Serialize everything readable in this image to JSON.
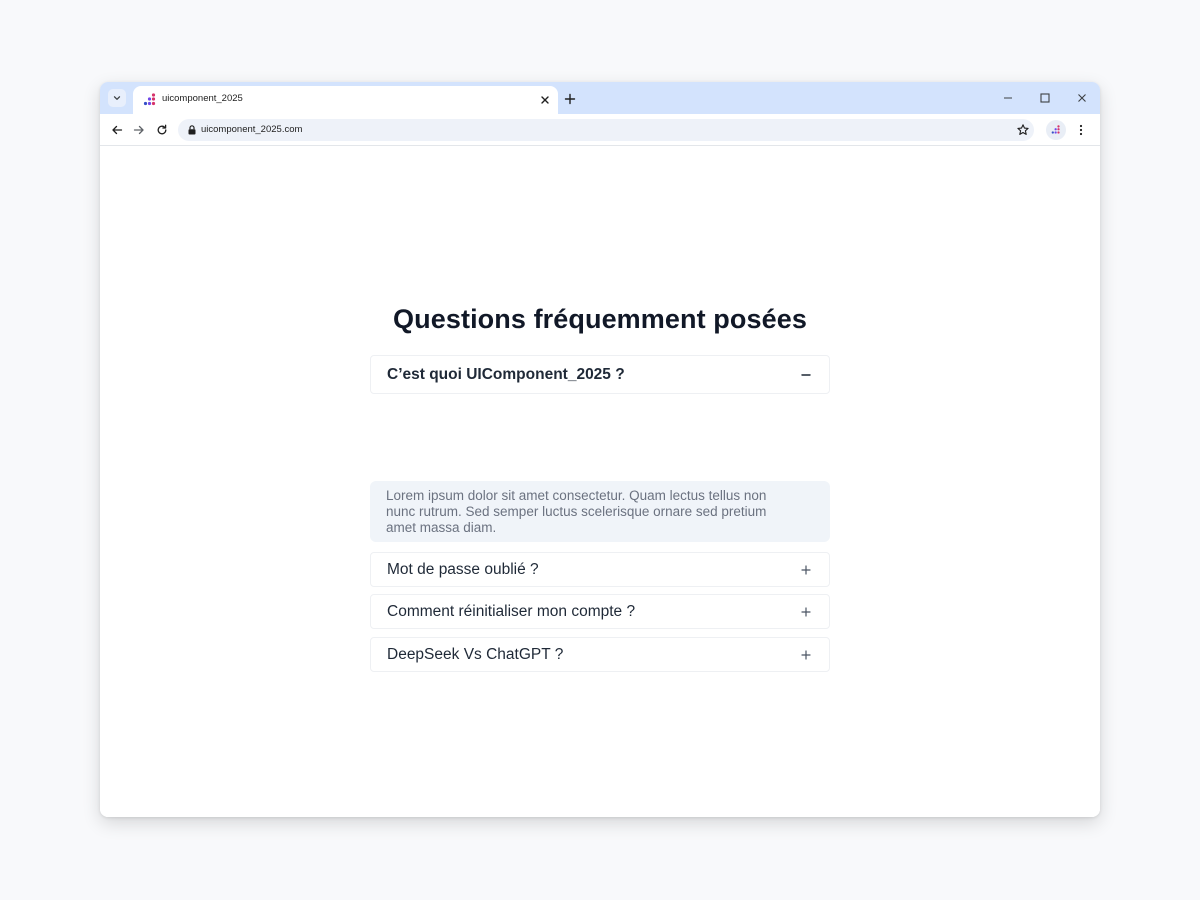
{
  "browser": {
    "tab_title": "uicomponent_2025",
    "url": "uicomponent_2025.com"
  },
  "icons": {
    "tab_list": "chevron-down-icon",
    "favicon": "dots-logo-icon",
    "tab_close": "close-icon",
    "new_tab": "plus-icon",
    "minimize": "minimize-icon",
    "maximize": "maximize-icon",
    "close_window": "close-icon",
    "back": "arrow-left-icon",
    "forward": "arrow-right-icon",
    "reload": "reload-icon",
    "lock": "lock-icon",
    "bookmark": "star-icon",
    "menu": "kebab-menu-icon",
    "expanded": "minus-icon",
    "collapsed": "plus-icon"
  },
  "colors": {
    "tab_bar": "#d3e3fd",
    "title_text": "#111827",
    "answer_background": "#f0f4f9",
    "answer_text": "#6b7280",
    "logo_pink": "#d6336c",
    "logo_purple": "#7048e8",
    "logo_navy": "#364fc7"
  },
  "faq": {
    "title": "Questions fréquemment posées",
    "items": [
      {
        "question": "C’est quoi UIComponent_2025 ?",
        "expanded": true,
        "answer": "Lorem ipsum dolor sit amet consectetur. Quam lectus tellus non nunc rutrum. Sed semper luctus scelerisque ornare sed pretium amet massa diam."
      },
      {
        "question": "Mot de passe oublié ?",
        "expanded": false
      },
      {
        "question": "Comment réinitialiser mon compte ?",
        "expanded": false
      },
      {
        "question": "DeepSeek Vs ChatGPT ?",
        "expanded": false
      }
    ]
  }
}
